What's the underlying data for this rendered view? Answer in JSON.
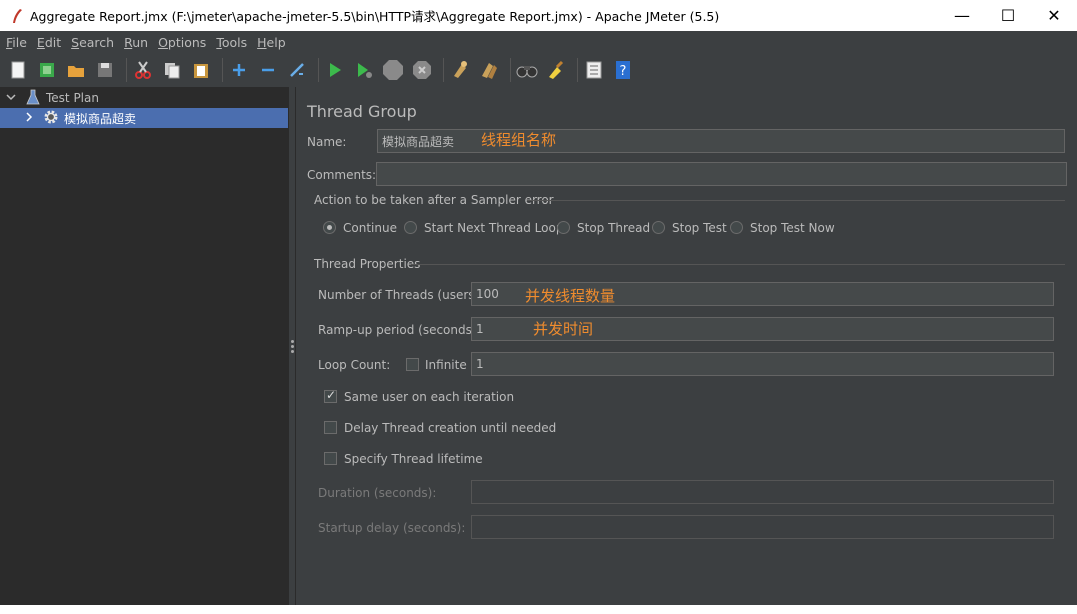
{
  "window": {
    "title": "Aggregate Report.jmx (F:\\jmeter\\apache-jmeter-5.5\\bin\\HTTP请求\\Aggregate Report.jmx) - Apache JMeter (5.5)",
    "minimize": "—",
    "maximize": "☐",
    "close": "✕"
  },
  "menu": [
    {
      "mnemonic": "F",
      "rest": "ile"
    },
    {
      "mnemonic": "E",
      "rest": "dit"
    },
    {
      "mnemonic": "S",
      "rest": "earch"
    },
    {
      "mnemonic": "R",
      "rest": "un"
    },
    {
      "mnemonic": "O",
      "rest": "ptions"
    },
    {
      "mnemonic": "T",
      "rest": "ools"
    },
    {
      "mnemonic": "H",
      "rest": "elp"
    }
  ],
  "toolbar": {
    "icons": [
      "new-icon",
      "templates-icon",
      "open-icon",
      "save-icon",
      "cut-icon",
      "copy-icon",
      "paste-icon",
      "expand-icon",
      "collapse-icon",
      "toggle-icon",
      "start-icon",
      "start-no-pause-icon",
      "stop-icon",
      "shutdown-icon",
      "clear-icon",
      "clear-all-icon",
      "search-icon",
      "reset-search-icon",
      "function-helper-icon",
      "help-icon"
    ]
  },
  "tree": {
    "root": "Test Plan",
    "child": "模拟商品超卖"
  },
  "thread_group": {
    "heading": "Thread Group",
    "name_label": "Name:",
    "name_value": "模拟商品超卖",
    "name_annotation": "线程组名称",
    "comments_label": "Comments:",
    "comments_value": "",
    "sampler_error_title": "Action to be taken after a Sampler error",
    "actions": [
      {
        "label": "Continue",
        "checked": true
      },
      {
        "label": "Start Next Thread Loop",
        "checked": false
      },
      {
        "label": "Stop Thread",
        "checked": false
      },
      {
        "label": "Stop Test",
        "checked": false
      },
      {
        "label": "Stop Test Now",
        "checked": false
      }
    ],
    "properties_title": "Thread Properties",
    "threads_label": "Number of Threads (users):",
    "threads_value": "100",
    "threads_annotation": "并发线程数量",
    "rampup_label": "Ramp-up period (seconds):",
    "rampup_value": "1",
    "rampup_annotation": "并发时间",
    "loop_label": "Loop Count:",
    "infinite_label": "Infinite",
    "infinite_checked": false,
    "loop_value": "1",
    "same_user_label": "Same user on each iteration",
    "same_user_checked": true,
    "delay_label": "Delay Thread creation until needed",
    "delay_checked": false,
    "lifetime_label": "Specify Thread lifetime",
    "lifetime_checked": false,
    "duration_label": "Duration (seconds):",
    "duration_value": "",
    "startup_label": "Startup delay (seconds):",
    "startup_value": ""
  }
}
